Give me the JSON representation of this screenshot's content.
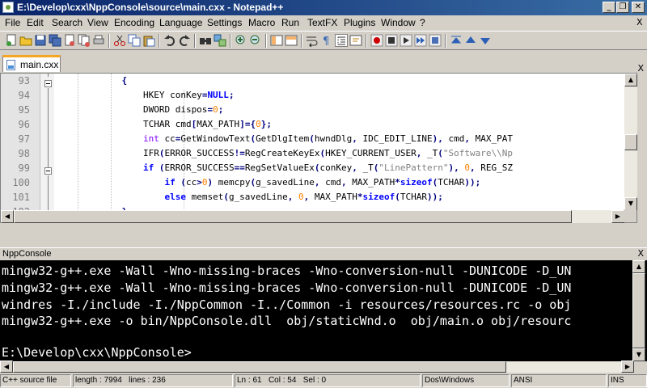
{
  "window": {
    "title": "E:\\Develop\\cxx\\NppConsole\\source\\main.cxx - Notepad++"
  },
  "menu": {
    "items": [
      "File",
      "Edit",
      "Search",
      "View",
      "Encoding",
      "Language",
      "Settings",
      "Macro",
      "Run",
      "TextFX",
      "Plugins",
      "Window",
      "?"
    ],
    "right_close": "X"
  },
  "tabs": [
    {
      "label": "main.cxx"
    }
  ],
  "tab_close": "X",
  "editor": {
    "lines": [
      {
        "num": "93",
        "code": "            {"
      },
      {
        "num": "94",
        "code": "                HKEY conKey=NULL;"
      },
      {
        "num": "95",
        "code": "                DWORD dispos=0;"
      },
      {
        "num": "96",
        "code": "                TCHAR cmd[MAX_PATH]={0};"
      },
      {
        "num": "97",
        "code": "                int cc=GetWindowText(GetDlgItem(hwndDlg, IDC_EDIT_LINE), cmd, MAX_PAT"
      },
      {
        "num": "98",
        "code": "                IFR(ERROR_SUCCESS!=RegCreateKeyEx(HKEY_CURRENT_USER, _T(\"Software\\\\Np"
      },
      {
        "num": "99",
        "code": "                if (ERROR_SUCCESS==RegSetValueEx(conKey, _T(\"LinePattern\"), 0, REG_SZ"
      },
      {
        "num": "100",
        "code": "                    if (cc>0) memcpy(g_savedLine, cmd, MAX_PATH*sizeof(TCHAR));"
      },
      {
        "num": "101",
        "code": "                    else memset(g_savedLine, 0, MAX_PATH*sizeof(TCHAR));"
      },
      {
        "num": "102",
        "code": "            }"
      }
    ]
  },
  "console": {
    "title": "NppConsole",
    "close": "X",
    "lines": [
      "mingw32-g++.exe -Wall -Wno-missing-braces -Wno-conversion-null -DUNICODE -D_UN",
      "mingw32-g++.exe -Wall -Wno-missing-braces -Wno-conversion-null -DUNICODE -D_UN",
      "windres -I./include -I./NppCommon -I../Common -i resources/resources.rc -o obj",
      "mingw32-g++.exe -o bin/NppConsole.dll  obj/staticWnd.o  obj/main.o obj/resourc",
      "",
      "E:\\Develop\\cxx\\NppConsole>"
    ]
  },
  "status": {
    "type": "C++ source file",
    "length": "length : 7994",
    "lines": "lines : 236",
    "ln": "Ln : 61",
    "col": "Col : 54",
    "sel": "Sel : 0",
    "eol": "Dos\\Windows",
    "encoding": "ANSI",
    "mode": "INS"
  },
  "colors": {
    "keyword": "#0000ff",
    "type_keyword": "#8000ff",
    "number": "#ff8000",
    "string": "#808080",
    "operator": "#000080",
    "active_tab": "#f5a623"
  }
}
